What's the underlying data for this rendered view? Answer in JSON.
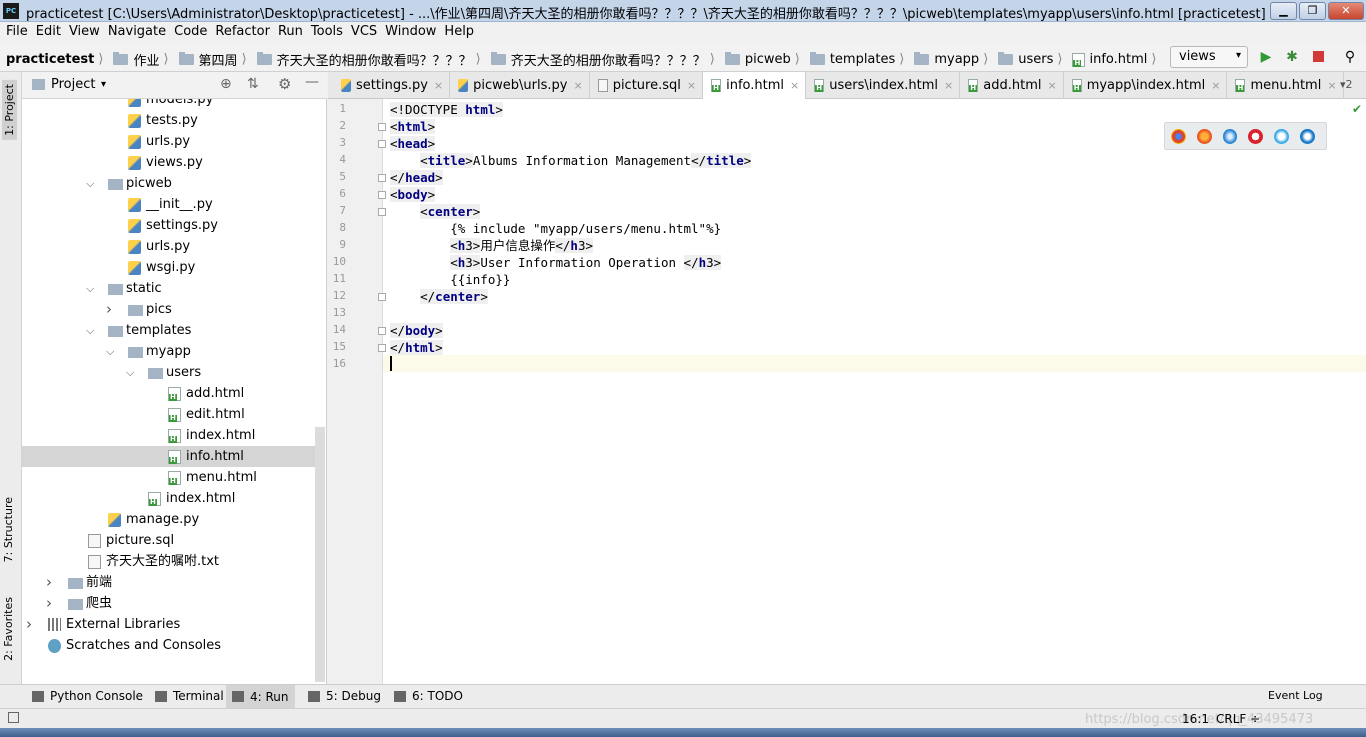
{
  "window": {
    "title": "practicetest [C:\\Users\\Administrator\\Desktop\\practicetest] - ...\\作业\\第四周\\齐天大圣的相册你敢看吗？？？？\\齐天大圣的相册你敢看吗？？？？\\picweb\\templates\\myapp\\users\\info.html [practicetest] - PyCharm (Administrator)",
    "logo": "PC",
    "controls": {
      "minimize": "▁",
      "maximize": "❐",
      "close": "✕"
    }
  },
  "menu": [
    "File",
    "Edit",
    "View",
    "Navigate",
    "Code",
    "Refactor",
    "Run",
    "Tools",
    "VCS",
    "Window",
    "Help"
  ],
  "breadcrumbs": [
    "practicetest",
    "作业",
    "第四周",
    "齐天大圣的相册你敢看吗？？？？",
    "齐天大圣的相册你敢看吗？？？？",
    "picweb",
    "templates",
    "myapp",
    "users",
    "info.html"
  ],
  "run_config": "views",
  "toolbar_icons": [
    "run-icon",
    "debug-icon",
    "stop-icon",
    "search-icon"
  ],
  "side_tabs": {
    "project": "1: Project",
    "structure": "7: Structure",
    "favorites": "2: Favorites"
  },
  "project_panel": {
    "title": "Project",
    "tree": [
      {
        "label": "models.py",
        "type": "py",
        "indent": 3
      },
      {
        "label": "tests.py",
        "type": "py",
        "indent": 3
      },
      {
        "label": "urls.py",
        "type": "py",
        "indent": 3
      },
      {
        "label": "views.py",
        "type": "py",
        "indent": 3
      },
      {
        "label": "picweb",
        "type": "dir",
        "indent": 2,
        "arrow": "down"
      },
      {
        "label": "__init__.py",
        "type": "py",
        "indent": 3
      },
      {
        "label": "settings.py",
        "type": "py",
        "indent": 3
      },
      {
        "label": "urls.py",
        "type": "py",
        "indent": 3
      },
      {
        "label": "wsgi.py",
        "type": "py",
        "indent": 3
      },
      {
        "label": "static",
        "type": "dir",
        "indent": 2,
        "arrow": "down"
      },
      {
        "label": "pics",
        "type": "dir",
        "indent": 3,
        "arrow": "right"
      },
      {
        "label": "templates",
        "type": "dir",
        "indent": 2,
        "arrow": "down"
      },
      {
        "label": "myapp",
        "type": "dir",
        "indent": 3,
        "arrow": "down"
      },
      {
        "label": "users",
        "type": "dir",
        "indent": 4,
        "arrow": "down"
      },
      {
        "label": "add.html",
        "type": "html",
        "indent": 5
      },
      {
        "label": "edit.html",
        "type": "html",
        "indent": 5
      },
      {
        "label": "index.html",
        "type": "html",
        "indent": 5
      },
      {
        "label": "info.html",
        "type": "html",
        "indent": 5,
        "selected": true
      },
      {
        "label": "menu.html",
        "type": "html",
        "indent": 5
      },
      {
        "label": "index.html",
        "type": "html",
        "indent": 4
      },
      {
        "label": "manage.py",
        "type": "py",
        "indent": 2
      },
      {
        "label": "picture.sql",
        "type": "file",
        "indent": 1
      },
      {
        "label": "齐天大圣的嘱咐.txt",
        "type": "file",
        "indent": 1
      },
      {
        "label": "前端",
        "type": "dir",
        "indent": 0,
        "arrow": "right"
      },
      {
        "label": "爬虫",
        "type": "dir",
        "indent": 0,
        "arrow": "right"
      },
      {
        "label": "External Libraries",
        "type": "lib",
        "indent": -1,
        "arrow": "right"
      },
      {
        "label": "Scratches and Consoles",
        "type": "scratch",
        "indent": -1
      }
    ]
  },
  "editor_tabs": [
    {
      "label": "settings.py",
      "type": "py"
    },
    {
      "label": "picweb\\urls.py",
      "type": "py"
    },
    {
      "label": "picture.sql",
      "type": "file"
    },
    {
      "label": "info.html",
      "type": "html",
      "active": true
    },
    {
      "label": "users\\index.html",
      "type": "html"
    },
    {
      "label": "add.html",
      "type": "html"
    },
    {
      "label": "myapp\\index.html",
      "type": "html"
    },
    {
      "label": "menu.html",
      "type": "html"
    }
  ],
  "tab_overflow": "▾2",
  "code_lines": [
    "<!DOCTYPE html>",
    "<html>",
    "<head>",
    "    <title>Albums Information Management</title>",
    "</head>",
    "<body>",
    "    <center>",
    "        {% include \"myapp/users/menu.html\"%}",
    "        <h3>用户信息操作</h3>",
    "        <h3>User Information Operation </h3>",
    "        {{info}}",
    "    </center>",
    "",
    "</body>",
    "</html>",
    ""
  ],
  "browser_icons": [
    "chrome-icon",
    "firefox-icon",
    "safari-icon",
    "opera-icon",
    "ie-icon",
    "edge-icon"
  ],
  "bottom_tabs": [
    {
      "label": "Python Console",
      "icon": "python-console-icon"
    },
    {
      "label": "Terminal",
      "icon": "terminal-icon"
    },
    {
      "label": "4: Run",
      "icon": "run-tab-icon",
      "active": true
    },
    {
      "label": "5: Debug",
      "icon": "debug-tab-icon"
    },
    {
      "label": "6: TODO",
      "icon": "todo-icon"
    }
  ],
  "event_log": "Event Log",
  "status": {
    "position": "16:1",
    "line_sep": "CRLF ÷",
    "watermark": "https://blog.csdn.net/qq_43495473"
  },
  "colors": {
    "tag": "#000080",
    "current_line": "#fcfae9",
    "selection": "#d5d5d5",
    "run": "#2e9b34",
    "stop": "#d13838"
  }
}
